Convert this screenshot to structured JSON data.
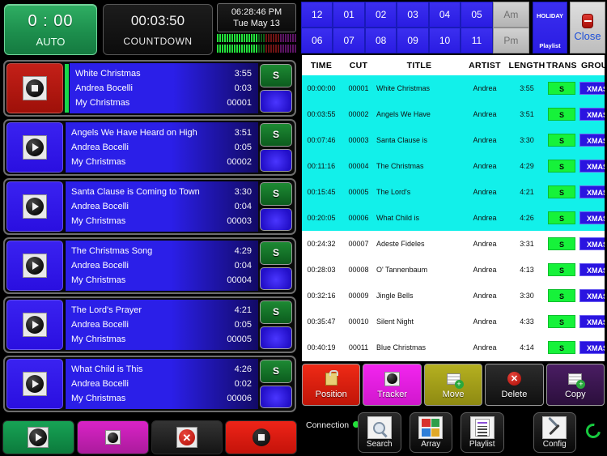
{
  "left_panel": {
    "auto_clock": {
      "time": "0 : 00",
      "mode": "AUTO"
    },
    "countdown": {
      "time": "00:03:50",
      "label": "COUNTDOWN"
    },
    "clock": {
      "time": "06:28:46 PM",
      "date": "Tue May 13"
    },
    "vu_meter_name": "audio-level-meter"
  },
  "playlist_items": [
    {
      "state": "stop",
      "icon": "stop-icon",
      "title": "White Christmas",
      "length": "3:55",
      "artist": "Andrea Bocelli",
      "elapsed": "0:03",
      "album": "My Christmas",
      "cut": "00001",
      "trans": "S",
      "has_green_bar": true
    },
    {
      "state": "play",
      "icon": "play-icon",
      "title": "Angels We Have Heard on High",
      "length": "3:51",
      "artist": "Andrea Bocelli",
      "elapsed": "0:05",
      "album": "My Christmas",
      "cut": "00002",
      "trans": "S",
      "has_green_bar": false
    },
    {
      "state": "play",
      "icon": "play-icon",
      "title": "Santa Clause is Coming to Town",
      "length": "3:30",
      "artist": "Andrea Bocelli",
      "elapsed": "0:04",
      "album": "My Christmas",
      "cut": "00003",
      "trans": "S",
      "has_green_bar": false
    },
    {
      "state": "play",
      "icon": "play-icon",
      "title": "The Christmas Song",
      "length": "4:29",
      "artist": "Andrea Bocelli",
      "elapsed": "0:04",
      "album": "My Christmas",
      "cut": "00004",
      "trans": "S",
      "has_green_bar": false
    },
    {
      "state": "play",
      "icon": "play-icon",
      "title": "The Lord's Prayer",
      "length": "4:21",
      "artist": "Andrea Bocelli",
      "elapsed": "0:05",
      "album": "My Christmas",
      "cut": "00005",
      "trans": "S",
      "has_green_bar": false
    },
    {
      "state": "play",
      "icon": "play-icon",
      "title": "What Child is This",
      "length": "4:26",
      "artist": "Andrea Bocelli",
      "elapsed": "0:02",
      "album": "My Christmas",
      "cut": "00006",
      "trans": "S",
      "has_green_bar": false
    }
  ],
  "transport": [
    {
      "name": "next-button",
      "icon": "next-track-icon",
      "color": "#17a355"
    },
    {
      "name": "tracker-button",
      "icon": "tracker-icon",
      "color": "#d923c7"
    },
    {
      "name": "delete-button",
      "icon": "delete-icon",
      "color": "#2c2c2c"
    },
    {
      "name": "stop-button",
      "icon": "stop-icon",
      "color": "#ee2418"
    }
  ],
  "keypad": {
    "hours": [
      "12",
      "01",
      "02",
      "03",
      "04",
      "05",
      "06",
      "07",
      "08",
      "09",
      "10",
      "11"
    ],
    "am_label": "Am",
    "pm_label": "Pm",
    "holiday": {
      "top": "HOLIDAY",
      "bottom": "Playlist"
    },
    "close": {
      "label": "Close",
      "icon": "close-icon"
    }
  },
  "table": {
    "columns": [
      "TIME",
      "CUT",
      "TITLE",
      "ARTIST",
      "LENGTH",
      "TRANS",
      "GROUP"
    ],
    "rows": [
      {
        "time": "00:00:00",
        "cut": "00001",
        "title": "White Christmas",
        "artist": "Andrea",
        "length": "3:55",
        "trans": "S",
        "group": "XMAS",
        "selected": true
      },
      {
        "time": "00:03:55",
        "cut": "00002",
        "title": "Angels We Have",
        "artist": "Andrea",
        "length": "3:51",
        "trans": "S",
        "group": "XMAS",
        "selected": true
      },
      {
        "time": "00:07:46",
        "cut": "00003",
        "title": "Santa Clause is",
        "artist": "Andrea",
        "length": "3:30",
        "trans": "S",
        "group": "XMAS",
        "selected": true
      },
      {
        "time": "00:11:16",
        "cut": "00004",
        "title": "The Christmas",
        "artist": "Andrea",
        "length": "4:29",
        "trans": "S",
        "group": "XMAS",
        "selected": true
      },
      {
        "time": "00:15:45",
        "cut": "00005",
        "title": "The Lord's",
        "artist": "Andrea",
        "length": "4:21",
        "trans": "S",
        "group": "XMAS",
        "selected": true
      },
      {
        "time": "00:20:05",
        "cut": "00006",
        "title": "What Child is",
        "artist": "Andrea",
        "length": "4:26",
        "trans": "S",
        "group": "XMAS",
        "selected": true
      },
      {
        "time": "00:24:32",
        "cut": "00007",
        "title": "Adeste Fideles",
        "artist": "Andrea",
        "length": "3:31",
        "trans": "S",
        "group": "XMAS",
        "selected": false
      },
      {
        "time": "00:28:03",
        "cut": "00008",
        "title": "O' Tannenbaum",
        "artist": "Andrea",
        "length": "4:13",
        "trans": "S",
        "group": "XMAS",
        "selected": false
      },
      {
        "time": "00:32:16",
        "cut": "00009",
        "title": "Jingle Bells",
        "artist": "Andrea",
        "length": "3:30",
        "trans": "S",
        "group": "XMAS",
        "selected": false
      },
      {
        "time": "00:35:47",
        "cut": "00010",
        "title": "Silent Night",
        "artist": "Andrea",
        "length": "4:33",
        "trans": "S",
        "group": "XMAS",
        "selected": false
      },
      {
        "time": "00:40:19",
        "cut": "00011",
        "title": "Blue Christmas",
        "artist": "Andrea",
        "length": "4:14",
        "trans": "S",
        "group": "XMAS",
        "selected": false
      }
    ]
  },
  "actions": [
    {
      "label": "Position",
      "icon": "lock-icon",
      "cls": "position"
    },
    {
      "label": "Tracker",
      "icon": "tracker-icon",
      "cls": "tracker"
    },
    {
      "label": "Move",
      "icon": "move-stack-icon",
      "cls": "move"
    },
    {
      "label": "Delete",
      "icon": "delete-icon",
      "cls": "delete"
    },
    {
      "label": "Copy",
      "icon": "copy-stack-icon",
      "cls": "copy"
    }
  ],
  "bottom_nav": {
    "connection_label": "Connection",
    "connection_status_color": "#23e03a",
    "buttons": [
      {
        "label": "Search",
        "icon": "search-icon"
      },
      {
        "label": "Array",
        "icon": "array-icon"
      },
      {
        "label": "Playlist",
        "icon": "playlist-icon"
      },
      {
        "label": "Config",
        "icon": "config-icon"
      }
    ],
    "refresh_icon": "refresh-icon"
  }
}
